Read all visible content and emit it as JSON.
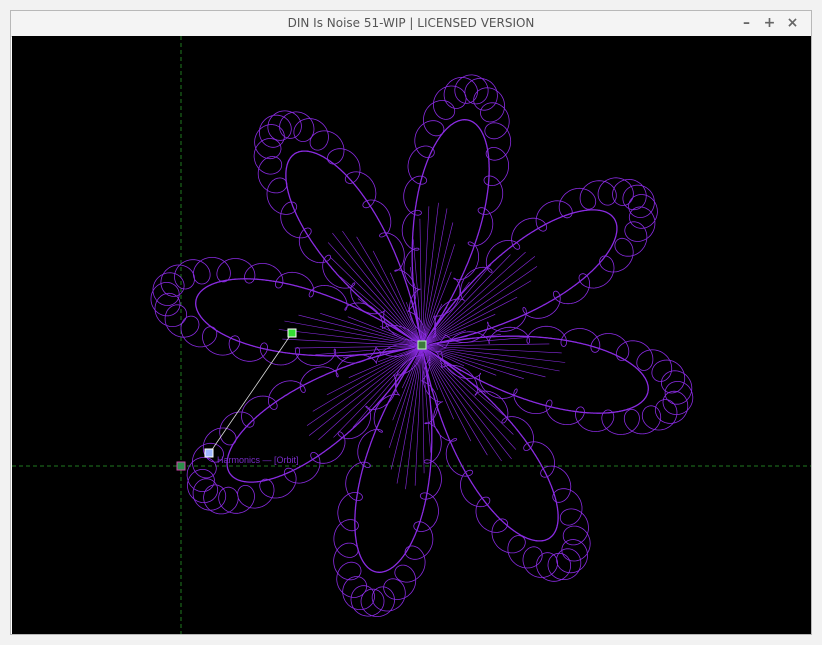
{
  "window": {
    "title": "DIN Is Noise 51-WIP | LICENSED VERSION",
    "minimize_glyph": "–",
    "maximize_glyph": "+",
    "close_glyph": "×"
  },
  "canvas": {
    "background": "#000000",
    "curve_color": "#8a2be2",
    "guide_color": "#1f7a1f",
    "handle_green": "#33dd33",
    "handle_blue": "#a0b8ff",
    "overlay_text": "Harmonics — [Orbit]"
  },
  "curve": {
    "petals": 8,
    "loops": 160
  }
}
